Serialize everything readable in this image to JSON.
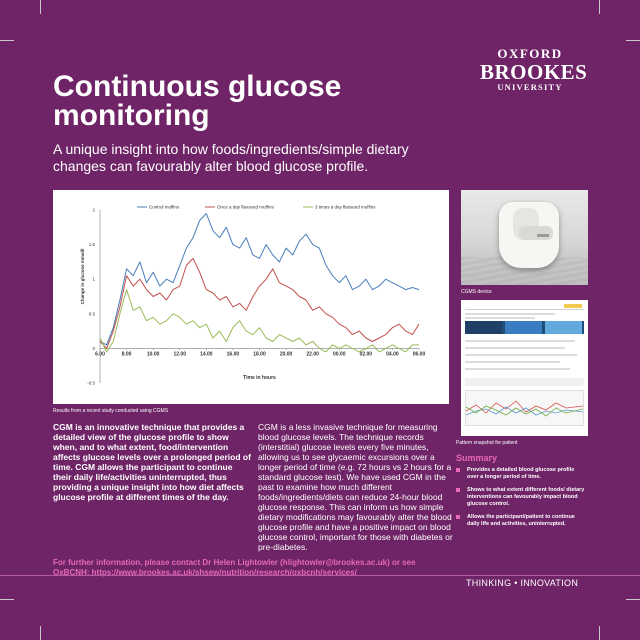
{
  "logo": {
    "line1": "OXFORD",
    "line2": "BROOKES",
    "line3": "UNIVERSITY"
  },
  "title": "Continuous glucose monitoring",
  "subtitle": "A unique insight into how foods/ingredients/simple dietary changes can favourably alter blood glucose profile.",
  "chart_caption": "Results from a recent study conducted using CGMS",
  "chart_data": {
    "type": "line",
    "xlabel": "Time in hours",
    "ylabel": "Change in glucose mmol/l",
    "x_ticks": [
      "6.00",
      "8.00",
      "10.00",
      "12.00",
      "14.00",
      "16.00",
      "18.00",
      "20.00",
      "22.00",
      "00.00",
      "02.00",
      "04.00",
      "06.00"
    ],
    "y_ticks": [
      "2",
      "1.5",
      "1",
      "0.5",
      "0",
      "-0.5"
    ],
    "ylim": [
      -0.5,
      2
    ],
    "xlim_hours": [
      0,
      24
    ],
    "legend_position": "top",
    "grid": false,
    "series": [
      {
        "name": "Control muffins",
        "color": "#4a7ebb",
        "x": [
          0,
          0.5,
          1,
          1.5,
          2,
          2.5,
          3,
          3.5,
          4,
          4.5,
          5,
          5.5,
          6,
          6.5,
          7,
          7.5,
          8,
          8.5,
          9,
          9.5,
          10,
          10.5,
          11,
          11.5,
          12,
          12.5,
          13,
          13.5,
          14,
          14.5,
          15,
          15.5,
          16,
          16.5,
          17,
          17.5,
          18,
          18.5,
          19,
          19.5,
          20,
          20.5,
          21,
          21.5,
          22,
          22.5,
          23,
          23.5,
          24
        ],
        "values": [
          0.1,
          0.05,
          0.3,
          0.7,
          1.15,
          1.05,
          1.25,
          0.95,
          1.1,
          0.9,
          1.0,
          0.95,
          1.2,
          1.45,
          1.6,
          1.85,
          1.95,
          1.7,
          1.6,
          1.75,
          1.5,
          1.45,
          1.6,
          1.35,
          1.3,
          1.5,
          1.35,
          1.25,
          1.45,
          1.35,
          1.55,
          1.65,
          1.5,
          1.45,
          1.2,
          1.05,
          0.95,
          1.05,
          0.85,
          0.9,
          1.0,
          0.85,
          0.9,
          1.0,
          0.95,
          0.9,
          0.85,
          0.88,
          0.85
        ]
      },
      {
        "name": "Once a day flaxseed muffins",
        "color": "#c0504d",
        "x": [
          0,
          0.5,
          1,
          1.5,
          2,
          2.5,
          3,
          3.5,
          4,
          4.5,
          5,
          5.5,
          6,
          6.5,
          7,
          7.5,
          8,
          8.5,
          9,
          9.5,
          10,
          10.5,
          11,
          11.5,
          12,
          12.5,
          13,
          13.5,
          14,
          14.5,
          15,
          15.5,
          16,
          16.5,
          17,
          17.5,
          18,
          18.5,
          19,
          19.5,
          20,
          20.5,
          21,
          21.5,
          22,
          22.5,
          23,
          23.5,
          24
        ],
        "values": [
          0.1,
          0.0,
          0.25,
          0.6,
          1.05,
          0.9,
          1.0,
          0.85,
          0.75,
          0.8,
          0.7,
          0.85,
          0.9,
          1.2,
          1.3,
          1.1,
          0.85,
          0.8,
          0.7,
          0.75,
          0.6,
          0.65,
          0.55,
          0.75,
          0.9,
          1.0,
          1.15,
          0.95,
          0.9,
          0.85,
          0.75,
          0.7,
          0.55,
          0.6,
          0.5,
          0.45,
          0.35,
          0.3,
          0.2,
          0.25,
          0.15,
          0.1,
          0.15,
          0.2,
          0.3,
          0.35,
          0.25,
          0.2,
          0.35
        ]
      },
      {
        "name": "3 times a day flaxseed muffins",
        "color": "#9bbb59",
        "x": [
          0,
          0.5,
          1,
          1.5,
          2,
          2.5,
          3,
          3.5,
          4,
          4.5,
          5,
          5.5,
          6,
          6.5,
          7,
          7.5,
          8,
          8.5,
          9,
          9.5,
          10,
          10.5,
          11,
          11.5,
          12,
          12.5,
          13,
          13.5,
          14,
          14.5,
          15,
          15.5,
          16,
          16.5,
          17,
          17.5,
          18,
          18.5,
          19,
          19.5,
          20,
          20.5,
          21,
          21.5,
          22,
          22.5,
          23,
          23.5,
          24
        ],
        "values": [
          0.15,
          -0.05,
          0.1,
          0.5,
          0.85,
          0.55,
          0.6,
          0.4,
          0.45,
          0.35,
          0.4,
          0.5,
          0.45,
          0.35,
          0.4,
          0.3,
          0.35,
          0.15,
          0.25,
          0.1,
          0.3,
          0.4,
          0.25,
          0.2,
          0.3,
          0.15,
          0.1,
          0.2,
          0.15,
          0.1,
          0.15,
          0.05,
          0.1,
          0.0,
          -0.05,
          0.05,
          0.0,
          0.05,
          0.0,
          -0.05,
          0.0,
          0.05,
          -0.05,
          0.0,
          0.05,
          0.0,
          -0.05,
          0.05,
          0.05
        ]
      }
    ]
  },
  "intro_text": "CGM is an innovative technique that provides a detailed view of the glucose profile to show when, and to what extent, food/intervention affects glucose levels over a prolonged period of time. CGM allows the participant to continue their daily life/activities uninterrupted, thus providing a unique insight into how diet affects glucose profile at different times of the day.",
  "detail_text": "CGM is a less invasive technique for measuring blood glucose levels. The technique records (interstitial) glucose levels every five minutes, allowing us to see glycaemic excursions over a longer period of time (e.g. 72 hours vs 2 hours for a standard glucose test). We have used CGM in the past to examine how much different foods/ingredients/diets can reduce 24-hour blood glucose response. This can inform us how simple dietary modifications may favourably alter the blood glucose profile and have a positive impact on blood glucose control, important for those with diabetes or pre-diabetes.",
  "device_caption": "CGMS device",
  "snapshot_caption": "Pattern snapshot for patient",
  "summary": {
    "title": "Summary",
    "items": [
      "Provides a detailed blood glucose profile over a longer period of time.",
      "Shows to what extent different foods/ dietary interventions can favourably impact blood glucose control.",
      "Allows the participant/patient to continue daily life and activities, uninterrupted."
    ]
  },
  "contact": "For further information, please contact Dr Helen Lightowler (hlightowler@brookes.ac.uk) or see OxBCNH: https://www.brookes.ac.uk/shsew/nutrition/research/oxbcnh/services/",
  "tagline": "THINKING • INNOVATION",
  "colors": {
    "background": "#6e2466",
    "accent": "#e868b6",
    "text": "#ffffff"
  }
}
